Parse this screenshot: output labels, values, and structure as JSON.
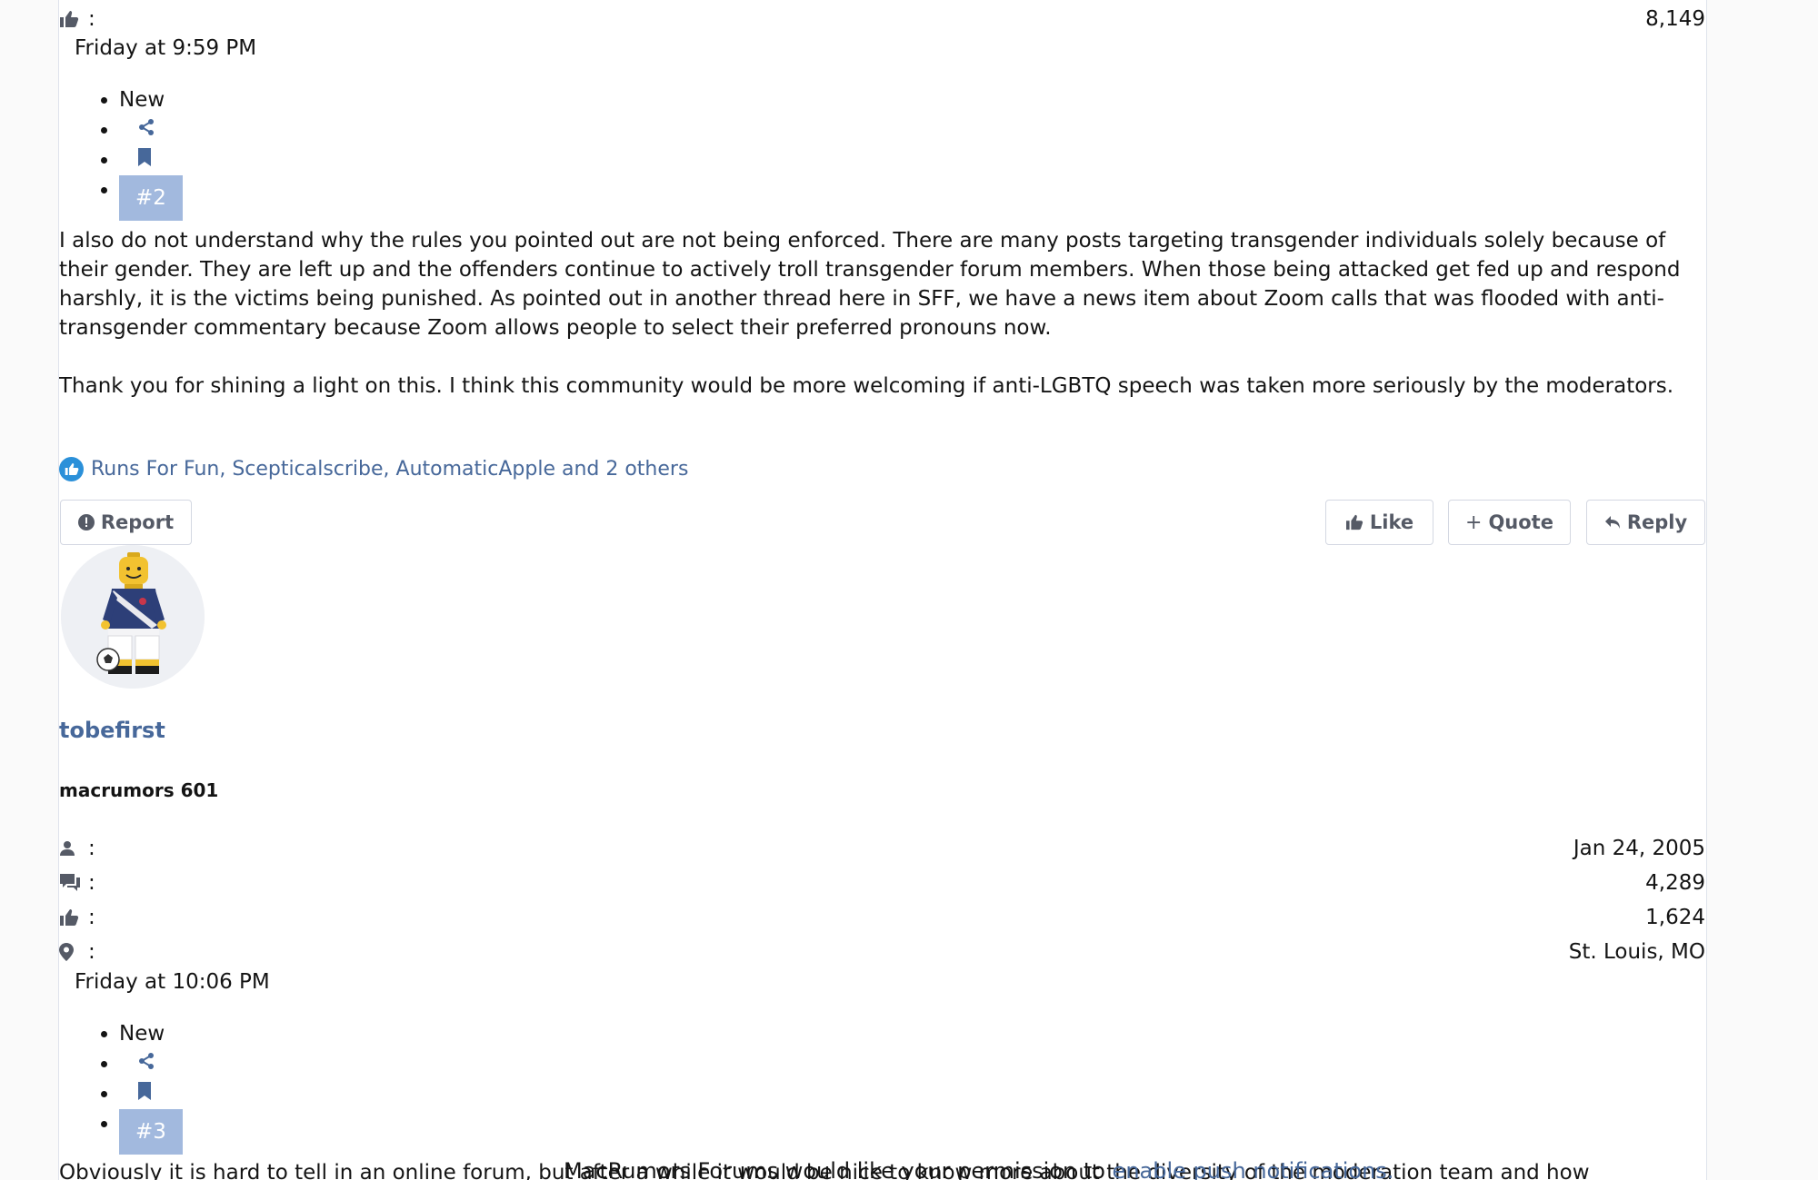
{
  "post2": {
    "top_likes": "8,149",
    "date": "Friday at 9:59 PM",
    "actions": {
      "new_label": "New",
      "share_icon": "share-icon",
      "bookmark_icon": "bookmark-icon",
      "number": "#2"
    },
    "paragraphs": [
      "I also do not understand why the rules you pointed out are not being enforced. There are many posts targeting transgender individuals solely because of their gender. They are left up and the offenders continue to actively troll transgender forum members. When those being attacked get fed up and respond harshly, it is the victims being punished. As pointed out in another thread here in SFF, we have a news item about Zoom calls that was flooded with anti-transgender commentary because Zoom allows people to select their preferred pronouns now.",
      "Thank you for shining a light on this. I think this community would be more welcoming if anti-LGBTQ speech was taken more seriously by the moderators."
    ],
    "reactions": "Runs For Fun, Scepticalscribe, AutomaticApple and 2 others",
    "buttons": {
      "report": "Report",
      "like": "Like",
      "quote": "Quote",
      "reply": "Reply"
    }
  },
  "user": {
    "name": "tobefirst",
    "title": "macrumors 601",
    "stats": [
      {
        "icon": "user-icon",
        "value": "Jan 24, 2005"
      },
      {
        "icon": "messages-icon",
        "value": "4,289"
      },
      {
        "icon": "thumbs-up-icon",
        "value": "1,624"
      },
      {
        "icon": "location-pin-icon",
        "value": "St. Louis, MO"
      }
    ]
  },
  "post3": {
    "date": "Friday at 10:06 PM",
    "actions": {
      "new_label": "New",
      "number": "#3"
    },
    "body_start": "Obviously it is hard to tell in an online forum, but after a while it would be nice to know more about the diversity of the moderation team and how"
  },
  "push_banner": {
    "text": "MacRumors Forums would like your permission to ",
    "link": "enable push notifications."
  },
  "colon": ":",
  "colors": {
    "link": "#47689a",
    "badge": "#a2b9de",
    "reaction": "#2b90d9"
  }
}
